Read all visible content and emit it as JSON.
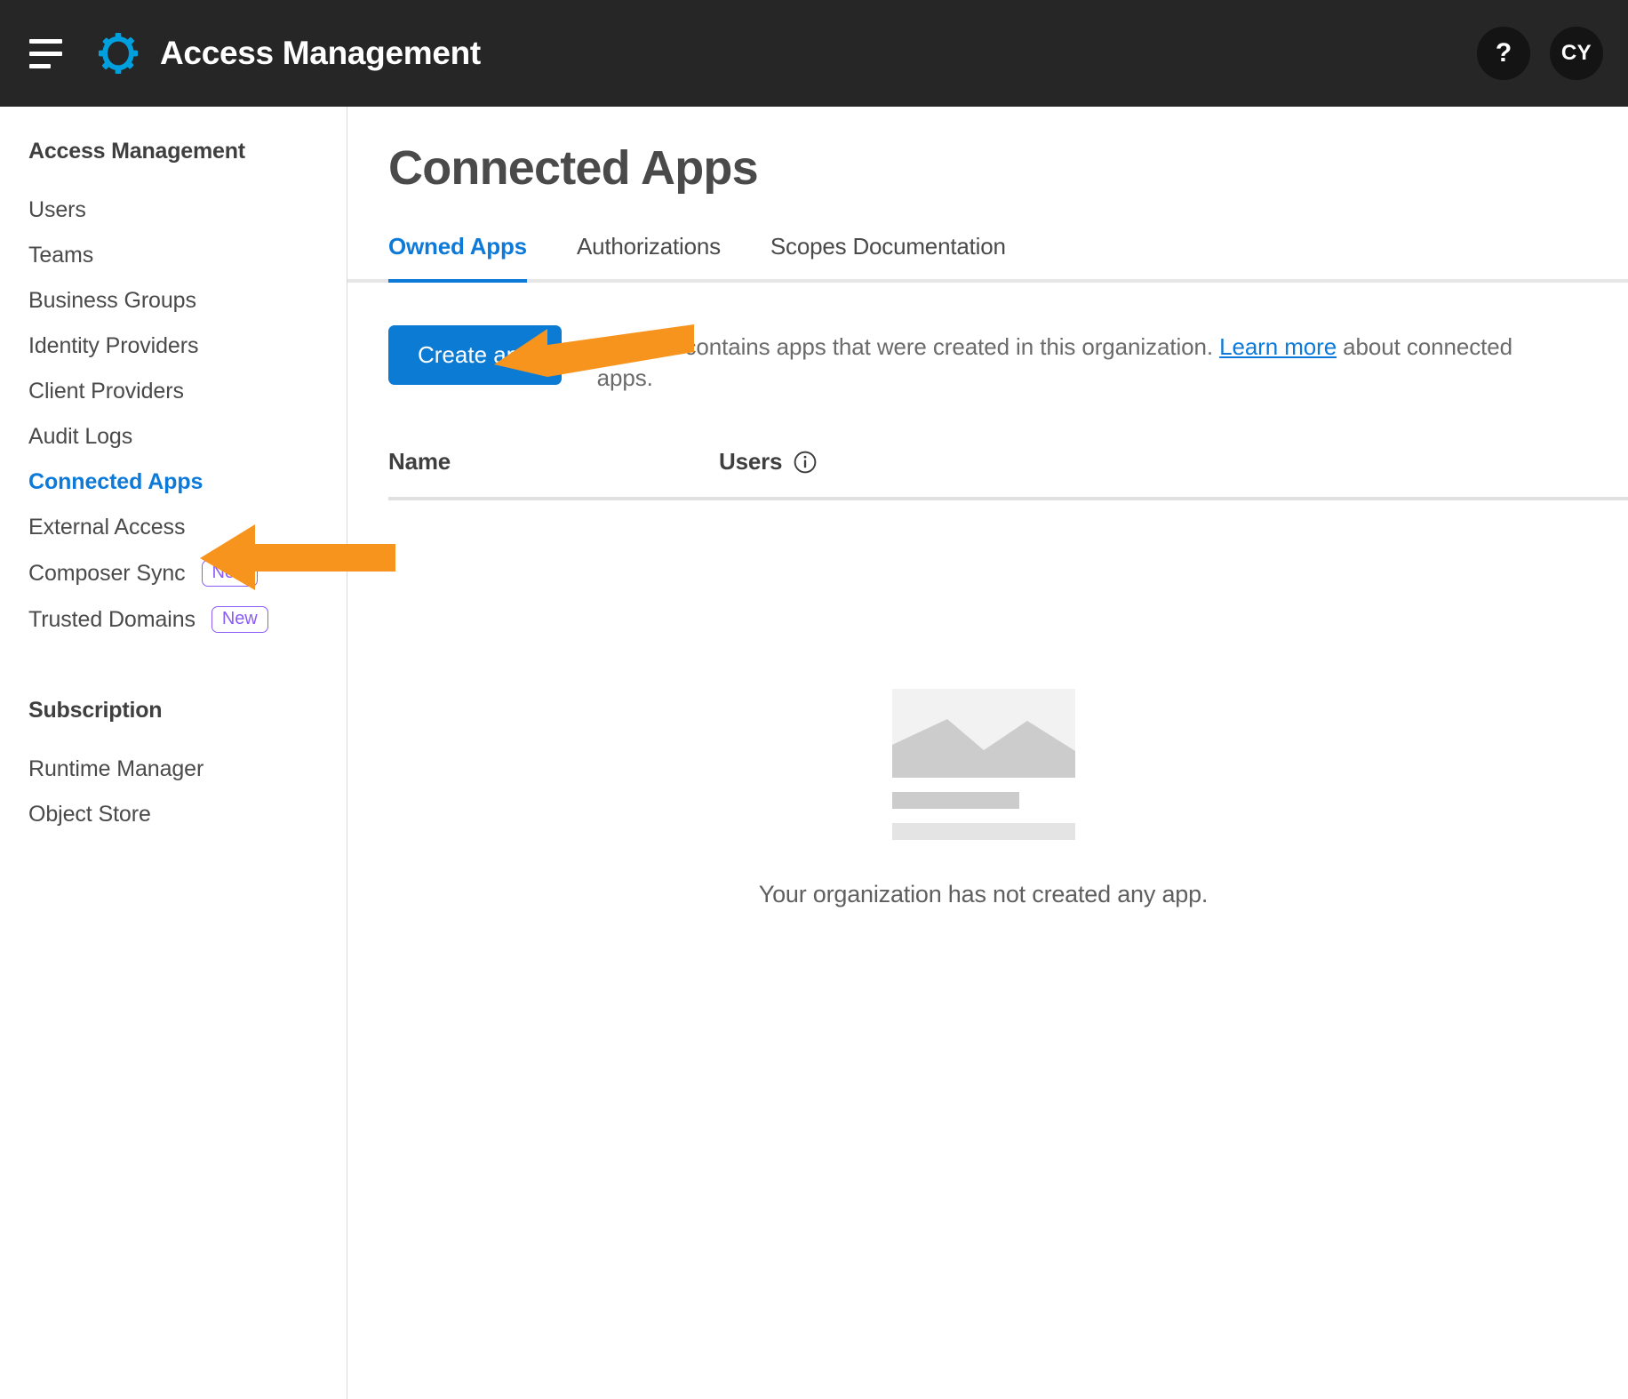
{
  "topbar": {
    "menu_icon": "hamburger-icon",
    "logo_icon": "gear-icon",
    "title": "Access Management",
    "help_label": "?",
    "avatar_label": "CY"
  },
  "sidebar": {
    "sections": [
      {
        "title": "Access Management",
        "items": [
          {
            "label": "Users",
            "active": false,
            "badge": null
          },
          {
            "label": "Teams",
            "active": false,
            "badge": null
          },
          {
            "label": "Business Groups",
            "active": false,
            "badge": null
          },
          {
            "label": "Identity Providers",
            "active": false,
            "badge": null
          },
          {
            "label": "Client Providers",
            "active": false,
            "badge": null
          },
          {
            "label": "Audit Logs",
            "active": false,
            "badge": null
          },
          {
            "label": "Connected Apps",
            "active": true,
            "badge": null
          },
          {
            "label": "External Access",
            "active": false,
            "badge": null
          },
          {
            "label": "Composer Sync",
            "active": false,
            "badge": "New"
          },
          {
            "label": "Trusted Domains",
            "active": false,
            "badge": "New"
          }
        ]
      },
      {
        "title": "Subscription",
        "items": [
          {
            "label": "Runtime Manager",
            "active": false,
            "badge": null
          },
          {
            "label": "Object Store",
            "active": false,
            "badge": null
          }
        ]
      }
    ]
  },
  "main": {
    "page_title": "Connected Apps",
    "tabs": [
      {
        "label": "Owned Apps",
        "active": true
      },
      {
        "label": "Authorizations",
        "active": false
      },
      {
        "label": "Scopes Documentation",
        "active": false
      }
    ],
    "create_button": "Create app",
    "description": {
      "before_link": "This tab contains apps that were created in this organization. ",
      "link": "Learn more",
      "after_link": " about connected apps."
    },
    "table": {
      "columns": [
        {
          "label": "Name",
          "info": false
        },
        {
          "label": "Users",
          "info": true
        }
      ],
      "rows": []
    },
    "empty_state": {
      "illustration": "image-placeholder-icon",
      "message": "Your organization has not created any app."
    }
  },
  "colors": {
    "topbar_bg": "#262626",
    "accent_blue": "#0d7ad9",
    "button_blue": "#0b7bd4",
    "badge_purple": "#8b5cf6",
    "annotation_orange": "#f7941e",
    "logo_cyan": "#00a0df"
  },
  "annotations": [
    {
      "name": "arrow-pointing-to-connected-apps",
      "direction": "left"
    },
    {
      "name": "arrow-pointing-to-create-app",
      "direction": "left"
    }
  ]
}
